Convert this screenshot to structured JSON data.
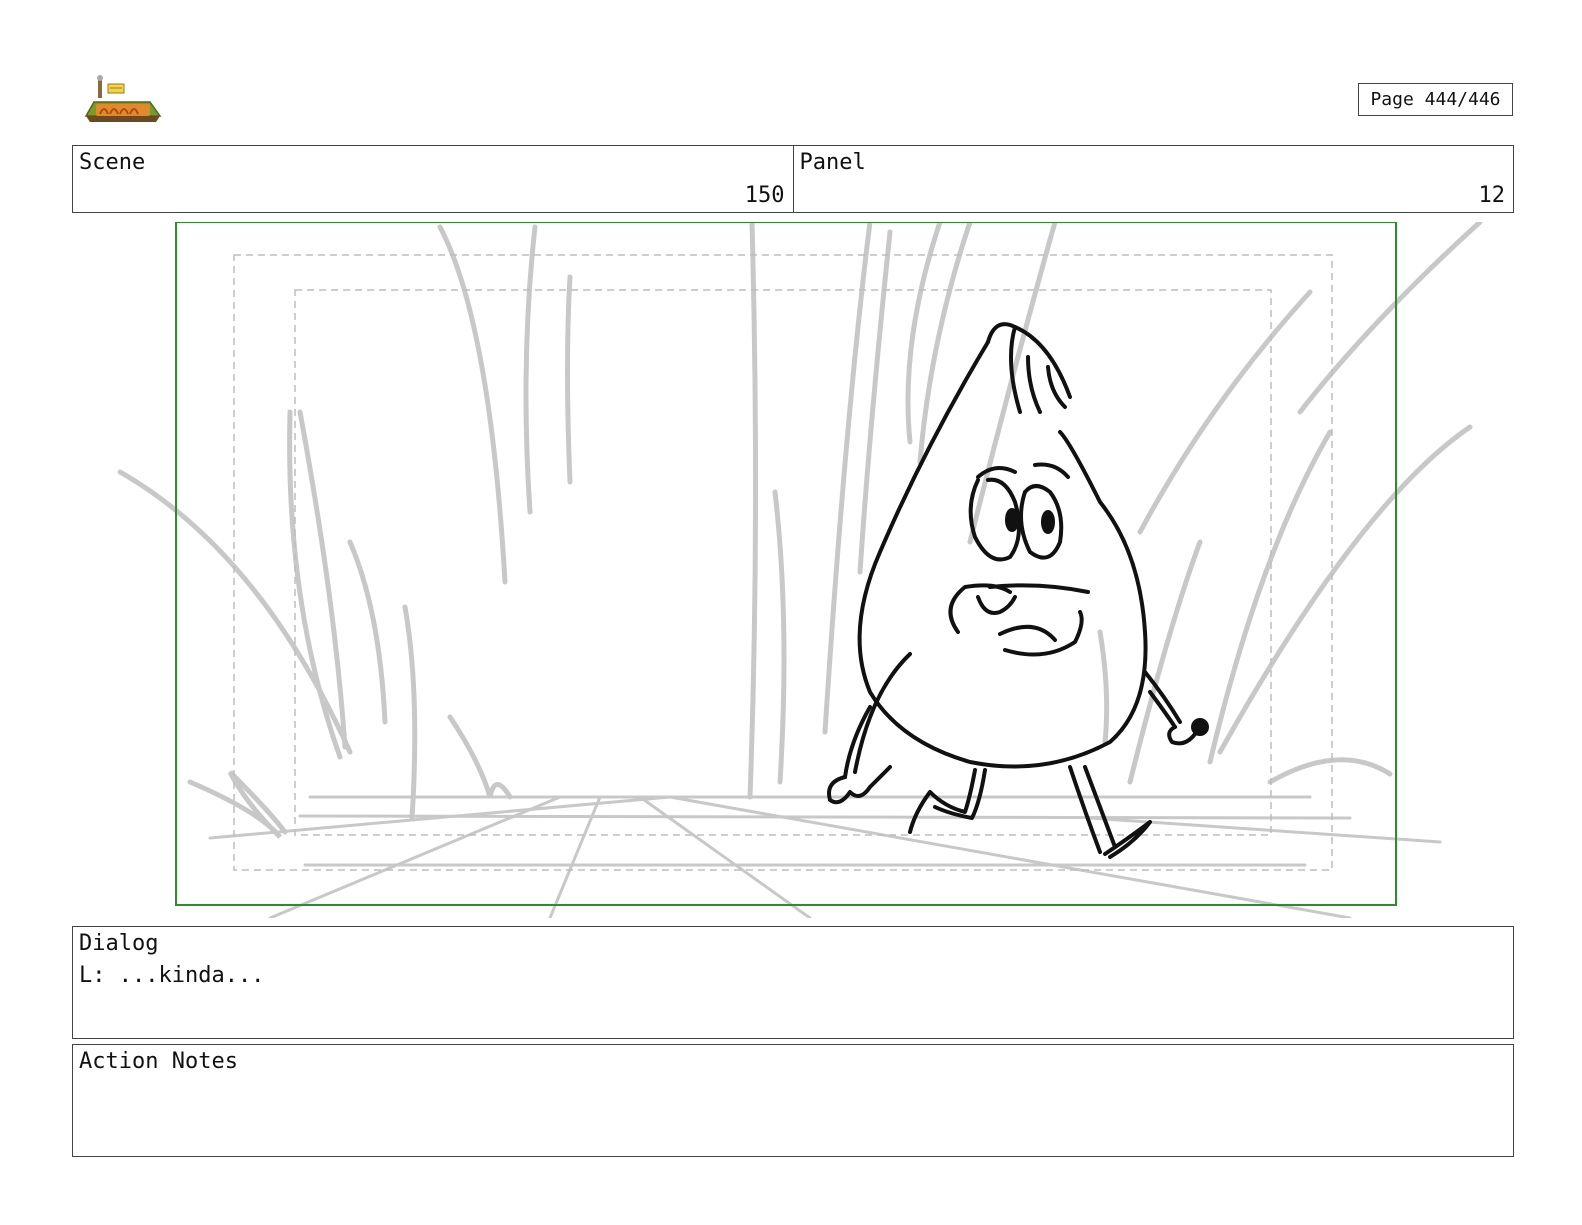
{
  "header": {
    "page_indicator": "Page 444/446"
  },
  "info": {
    "scene_label": "Scene",
    "scene_value": "150",
    "panel_label": "Panel",
    "panel_value": "12"
  },
  "dialog": {
    "label": "Dialog",
    "text": "L: ...kinda..."
  },
  "action_notes": {
    "label": "Action Notes",
    "text": ""
  },
  "colors": {
    "frame_border": "#2e8b2e",
    "sketch_gray": "#c8c8c8",
    "ink": "#111111"
  }
}
